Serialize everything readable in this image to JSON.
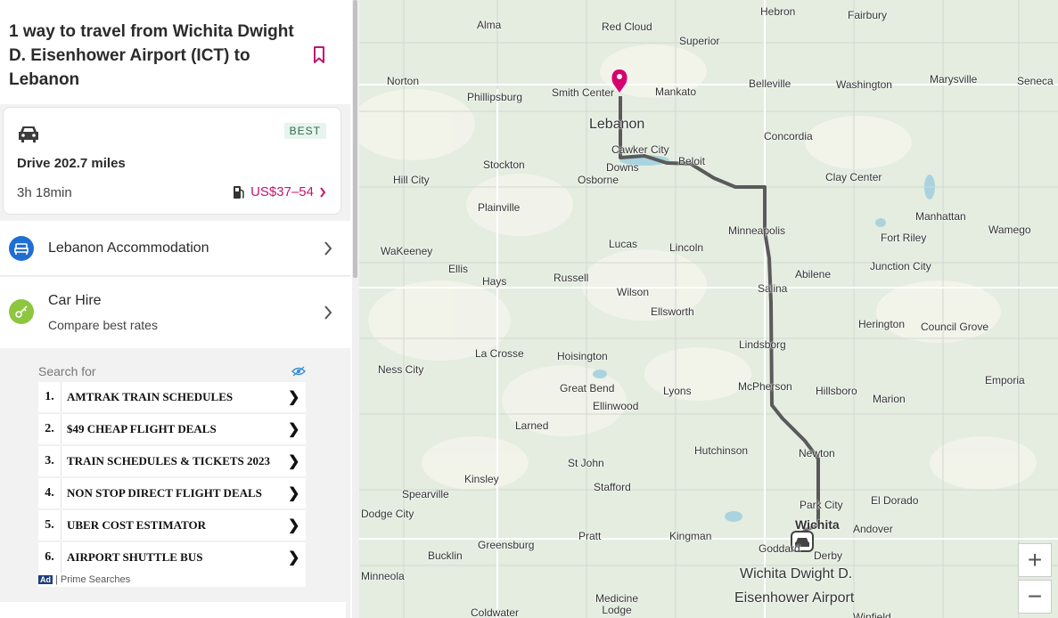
{
  "route": {
    "title": "1 way to travel from Wichita Dwight D. Eisenhower Airport (ICT) to Lebanon",
    "best_badge": "BEST",
    "drive_label": "Drive 202.7 miles",
    "duration": "3h 18min",
    "price": "US$37–54"
  },
  "links": {
    "accommodation": "Lebanon Accommodation",
    "car_hire_title": "Car Hire",
    "car_hire_sub": "Compare best rates"
  },
  "ad": {
    "header": "Search for",
    "items": [
      {
        "num": "1.",
        "text": "AMTRAK TRAIN SCHEDULES"
      },
      {
        "num": "2.",
        "text": "$49 CHEAP FLIGHT DEALS"
      },
      {
        "num": "3.",
        "text": "TRAIN SCHEDULES & TICKETS 2023"
      },
      {
        "num": "4.",
        "text": "NON STOP DIRECT FLIGHT DEALS"
      },
      {
        "num": "5.",
        "text": "UBER COST ESTIMATOR"
      },
      {
        "num": "6.",
        "text": "AIRPORT SHUTTLE BUS"
      }
    ],
    "badge": "Ad",
    "footer": "Prime Searches"
  },
  "map": {
    "destination_label": "Lebanon",
    "origin_label_1": "Wichita Dwight D.",
    "origin_label_2": "Eisenhower Airport",
    "towns": [
      "Hebron",
      "Fairbury",
      "Alma",
      "Red Cloud",
      "Superior",
      "Norton",
      "Phillipsburg",
      "Smith Center",
      "Mankato",
      "Belleville",
      "Washington",
      "Marysville",
      "Seneca",
      "Cawker City",
      "Downs",
      "Beloit",
      "Concordia",
      "Stockton",
      "Osborne",
      "Hill City",
      "Clay Center",
      "Plainville",
      "Manhattan",
      "Wamego",
      "Minneapolis",
      "Fort Riley",
      "Junction City",
      "Lucas",
      "Lincoln",
      "WaKeeney",
      "Ellis",
      "Hays",
      "Russell",
      "Wilson",
      "Abilene",
      "Salina",
      "Ellsworth",
      "Herington",
      "Council Grove",
      "Lindsborg",
      "La Crosse",
      "Hoisington",
      "Ness City",
      "Great Bend",
      "Lyons",
      "McPherson",
      "Hillsboro",
      "Emporia",
      "Ellinwood",
      "Marion",
      "Larned",
      "Hutchinson",
      "Newton",
      "St John",
      "Kinsley",
      "Stafford",
      "Spearville",
      "El Dorado",
      "Park City",
      "Dodge City",
      "Wichita",
      "Andover",
      "Pratt",
      "Kingman",
      "Greensburg",
      "Goddard",
      "Derby",
      "Bucklin",
      "Minneola",
      "Medicine Lodge",
      "Coldwater",
      "Winfield"
    ],
    "zoom_in": "+",
    "zoom_out": "−",
    "accent": "#d6006f"
  }
}
